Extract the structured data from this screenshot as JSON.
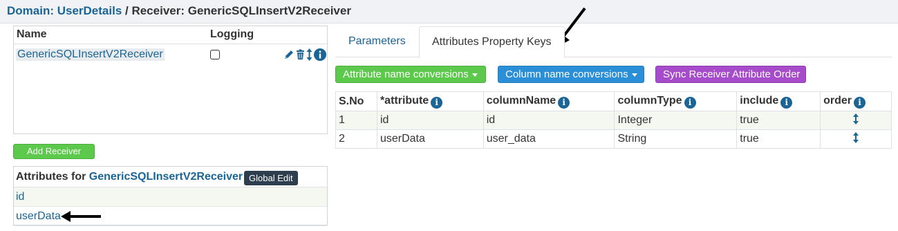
{
  "header": {
    "domain_label": "Domain: UserDetails",
    "separator": " / ",
    "receiver_label": "Receiver: GenericSQLInsertV2Receiver"
  },
  "receivers": {
    "col_name": "Name",
    "col_logging": "Logging",
    "rows": [
      {
        "name": "GenericSQLInsertV2Receiver",
        "logging": false
      }
    ],
    "add_button": "Add Receiver"
  },
  "attributes_panel": {
    "title_prefix": "Attributes for ",
    "title_receiver": "GenericSQLInsertV2Receiver",
    "global_edit": "Global Edit",
    "items": [
      "id",
      "userData"
    ]
  },
  "tabs": {
    "items": [
      {
        "label": "Parameters",
        "active": false
      },
      {
        "label": "Attributes Property Keys",
        "active": true
      }
    ]
  },
  "actions": {
    "attribute_conversions": "Attribute name conversions",
    "column_conversions": "Column name conversions",
    "sync_order": "Sync Receiver Attribute Order"
  },
  "table": {
    "headers": [
      "S.No",
      "*attribute",
      "columnName",
      "columnType",
      "include",
      "order"
    ],
    "rows": [
      {
        "sno": "1",
        "attribute": "id",
        "columnName": "id",
        "columnType": "Integer",
        "include": "true"
      },
      {
        "sno": "2",
        "attribute": "userData",
        "columnName": "user_data",
        "columnType": "String",
        "include": "true"
      }
    ]
  },
  "icons": {
    "info_glyph": "i",
    "edit": "pencil-icon",
    "delete": "trash-icon",
    "sort": "sort-arrows-icon"
  },
  "colors": {
    "link": "#1a6496",
    "green": "#5cc94c",
    "blue": "#2a8fd6",
    "purple": "#a64bc9",
    "dark": "#2d3e4e"
  }
}
